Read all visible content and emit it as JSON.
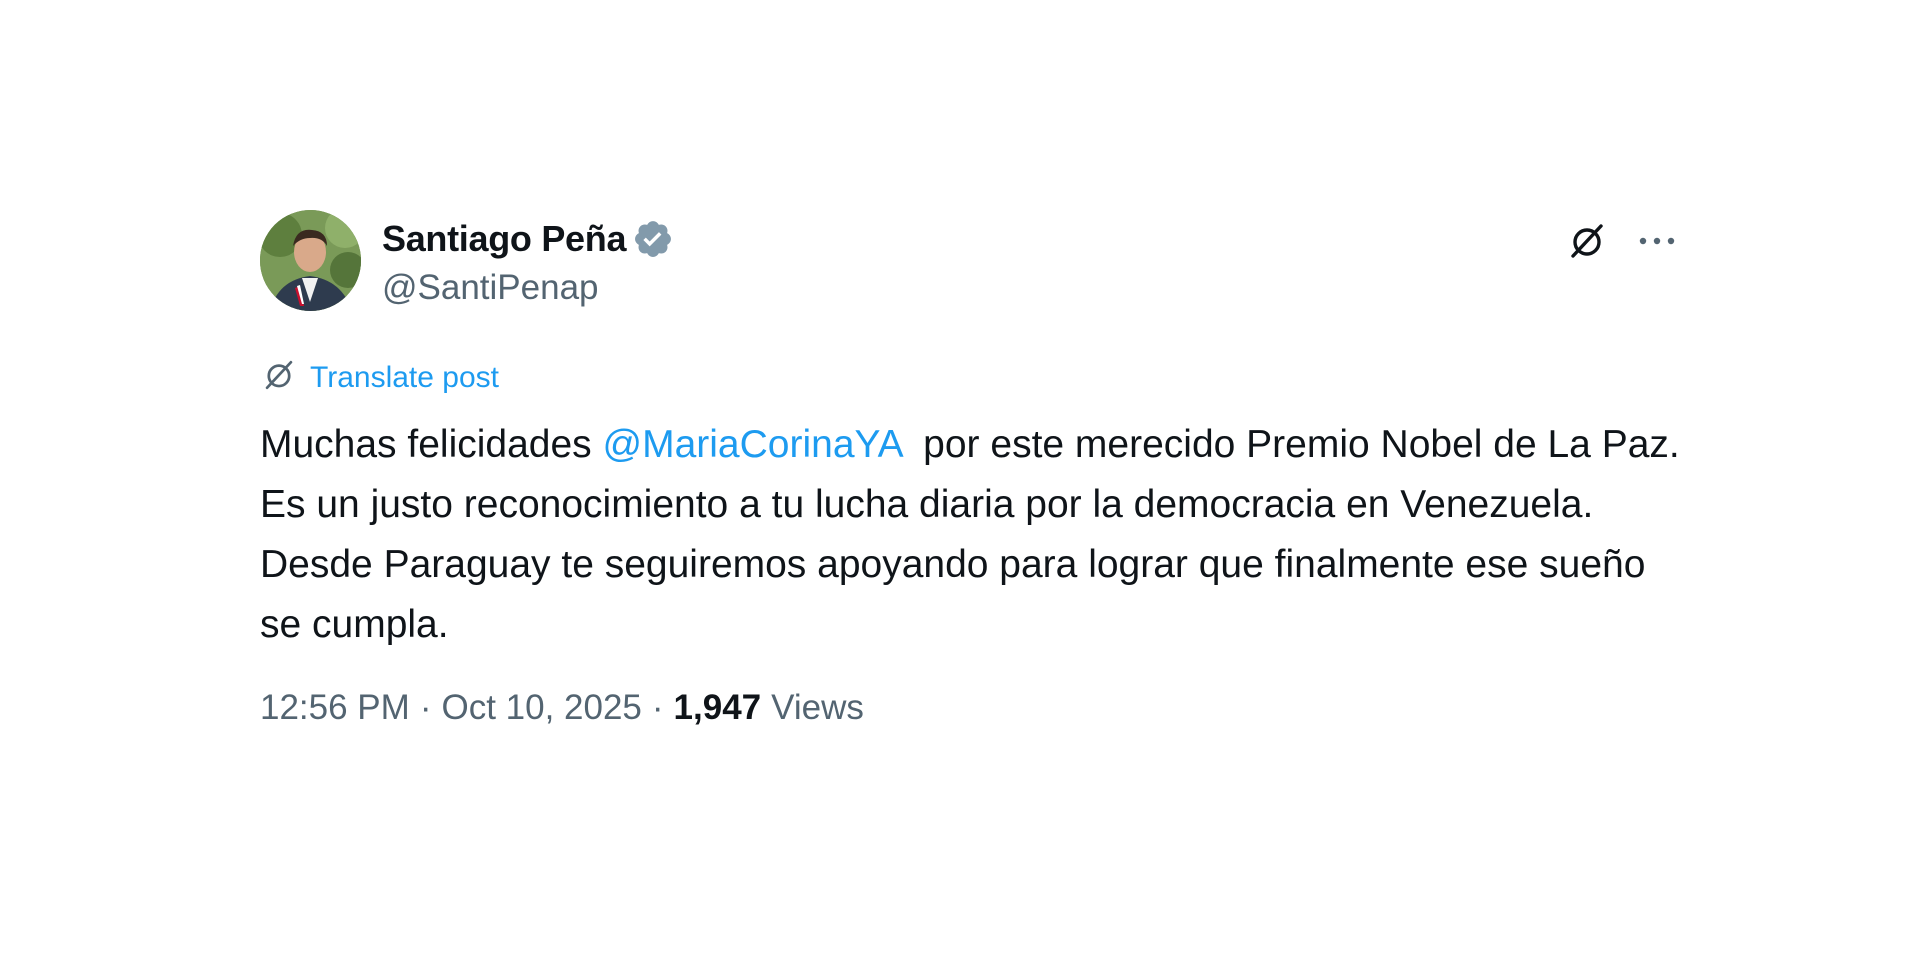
{
  "author": {
    "display_name": "Santiago Peña",
    "handle": "@SantiPenap",
    "verified_icon": "verified-badge-icon"
  },
  "actions": {
    "grok_icon": "grok-icon",
    "more_icon": "more-dots-icon"
  },
  "translate": {
    "icon": "translate-icon",
    "label": "Translate post"
  },
  "post": {
    "text_before": "Muchas felicidades ",
    "mention": "@MariaCorinaYA",
    "text_after": "  por este merecido Premio Nobel de La Paz. Es un justo reconocimiento a tu lucha diaria por la democracia en Venezuela. Desde Paraguay te seguiremos apoyando para lograr que finalmente ese sueño se cumpla."
  },
  "meta": {
    "time": "12:56 PM",
    "separator": "·",
    "date": "Oct 10, 2025",
    "views_count": "1,947",
    "views_label": "Views"
  },
  "colors": {
    "link": "#1d9bf0",
    "secondary": "#536471",
    "primary": "#0f1419",
    "verified": "#829aab"
  }
}
